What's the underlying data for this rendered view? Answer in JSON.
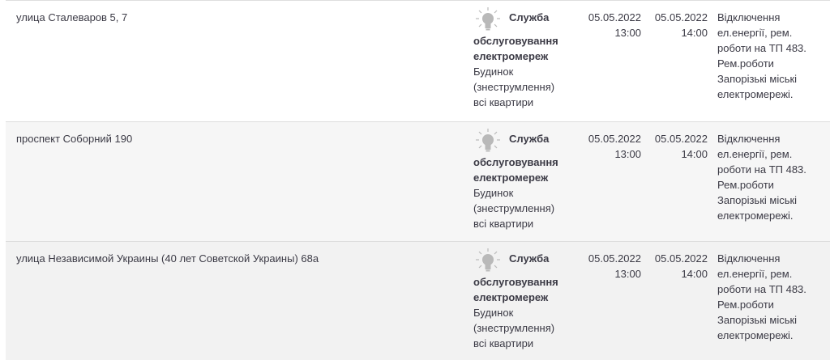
{
  "rows": [
    {
      "address": "улица Сталеваров 5, 7",
      "service_title": "Служба",
      "service_name_1": "обслуговування",
      "service_name_2": "електромереж",
      "target_1": "Будинок",
      "target_2": "(знеструмлення)",
      "target_3": "всі квартири",
      "start_date": "05.05.2022",
      "start_time": "13:00",
      "end_date": "05.05.2022",
      "end_time": "14:00",
      "desc_1": "Відключення",
      "desc_2": "ел.енергії, рем.",
      "desc_3": "роботи на ТП 483.",
      "desc_4": "Рем.роботи",
      "desc_5": "Запорізькі міські",
      "desc_6": "електромережі."
    },
    {
      "address": "проспект Соборний 190",
      "service_title": "Служба",
      "service_name_1": "обслуговування",
      "service_name_2": "електромереж",
      "target_1": "Будинок",
      "target_2": "(знеструмлення)",
      "target_3": "всі квартири",
      "start_date": "05.05.2022",
      "start_time": "13:00",
      "end_date": "05.05.2022",
      "end_time": "14:00",
      "desc_1": "Відключення",
      "desc_2": "ел.енергії, рем.",
      "desc_3": "роботи на ТП 483.",
      "desc_4": "Рем.роботи",
      "desc_5": "Запорізькі міські",
      "desc_6": "електромережі."
    },
    {
      "address": "улица Независимой Украины (40 лет Советской Украины) 68а",
      "service_title": "Служба",
      "service_name_1": "обслуговування",
      "service_name_2": "електромереж",
      "target_1": "Будинок",
      "target_2": "(знеструмлення)",
      "target_3": "всі квартири",
      "start_date": "05.05.2022",
      "start_time": "13:00",
      "end_date": "05.05.2022",
      "end_time": "14:00",
      "desc_1": "Відключення",
      "desc_2": "ел.енергії, рем.",
      "desc_3": "роботи на ТП 483.",
      "desc_4": "Рем.роботи",
      "desc_5": "Запорізькі міські",
      "desc_6": "електромережі."
    }
  ],
  "icons": {
    "service": "lightbulb-icon"
  },
  "colors": {
    "text": "#3b3a45",
    "icon": "#b9b9b9",
    "row_alt": "#f6f6f6",
    "border": "#dedede"
  }
}
